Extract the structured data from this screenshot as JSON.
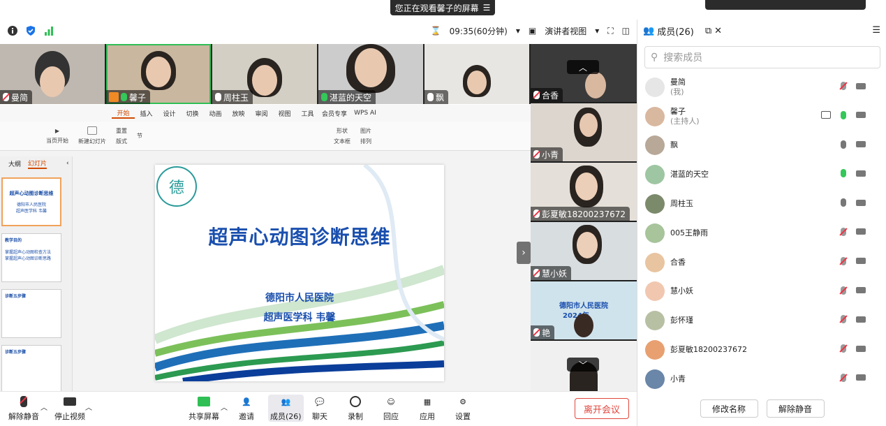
{
  "banner": {
    "text": "您正在观看馨子的屏幕"
  },
  "topbar": {
    "timer": "09:35(60分钟)",
    "view_mode": "演讲者视图"
  },
  "video_strip": [
    {
      "name": "曼简",
      "mic": "muted"
    },
    {
      "name": "馨子",
      "mic": "green",
      "host_badge": true
    },
    {
      "name": "周柱玉",
      "mic": "on"
    },
    {
      "name": "湛蓝的天空",
      "mic": "green"
    },
    {
      "name": "飘",
      "mic": "on"
    }
  ],
  "right_tiles": [
    {
      "name": "合香",
      "mic": "muted"
    },
    {
      "name": "小青",
      "mic": "muted"
    },
    {
      "name": "彭夏敏18200237672",
      "mic": "muted"
    },
    {
      "name": "慧小妖",
      "mic": "muted"
    },
    {
      "name": "艳",
      "mic": "muted",
      "slide_text": "德阳市人民医院",
      "slide_text2": "2024年"
    },
    {
      "name": "",
      "mic": "none"
    }
  ],
  "wps": {
    "menu": [
      "开始",
      "插入",
      "设计",
      "切换",
      "动画",
      "放映",
      "审阅",
      "视图",
      "工具",
      "会员专享",
      "WPS AI"
    ],
    "active_menu": "开始",
    "ribbon": {
      "from_current": "当页开始",
      "new_slide": "新建幻灯片",
      "layout": "版式",
      "section": "节",
      "reset": "重置",
      "shape": "形状",
      "image": "图片",
      "textbox": "文本框",
      "arrange": "排列"
    },
    "pane_tabs": [
      "大纲",
      "幻灯片"
    ],
    "thumbs": [
      {
        "title": "超声心动图诊断思维",
        "line1": "德阳市人民医院",
        "line2": "超声医学科 韦馨"
      },
      {
        "title": "教学目的",
        "line1": "掌握超声心动图检查方法",
        "line2": "掌握超声心动图诊断思路"
      },
      {
        "title": "诊断五步骤",
        "line1": "",
        "line2": ""
      },
      {
        "title": "诊断五步骤",
        "line1": "",
        "line2": ""
      }
    ],
    "slide": {
      "logo_char": "德",
      "title": "超声心动图诊断思维",
      "hospital": "德阳市人民医院",
      "dept": "超声医学科  韦馨"
    }
  },
  "bottombar": {
    "unmute": "解除静音",
    "stop_video": "停止视频",
    "share": "共享屏幕",
    "invite": "邀请",
    "members": "成员(26)",
    "chat": "聊天",
    "record": "录制",
    "react": "回应",
    "apps": "应用",
    "settings": "设置",
    "leave": "离开会议"
  },
  "panel": {
    "title": "成员(26)",
    "search_placeholder": "搜索成员",
    "members": [
      {
        "name": "曼简",
        "role": "(我)",
        "mic": "muted",
        "share": false
      },
      {
        "name": "馨子",
        "role": "(主持人)",
        "mic": "green",
        "share": true
      },
      {
        "name": "飘",
        "role": "",
        "mic": "on",
        "share": false
      },
      {
        "name": "湛蓝的天空",
        "role": "",
        "mic": "green",
        "share": false
      },
      {
        "name": "周柱玉",
        "role": "",
        "mic": "on",
        "share": false
      },
      {
        "name": "005王静雨",
        "role": "",
        "mic": "muted",
        "share": false
      },
      {
        "name": "合香",
        "role": "",
        "mic": "muted",
        "share": false
      },
      {
        "name": "慧小妖",
        "role": "",
        "mic": "muted",
        "share": false
      },
      {
        "name": "彭怀瑾",
        "role": "",
        "mic": "muted",
        "share": false
      },
      {
        "name": "彭夏敏18200237672",
        "role": "",
        "mic": "muted",
        "share": false
      },
      {
        "name": "小青",
        "role": "",
        "mic": "muted",
        "share": false
      }
    ],
    "rename": "修改名称",
    "unmute": "解除静音"
  },
  "colors": {
    "accent_green": "#34c759",
    "leave_red": "#e0453b",
    "slide_blue": "#1a4fae",
    "wps_orange": "#d04a02"
  }
}
